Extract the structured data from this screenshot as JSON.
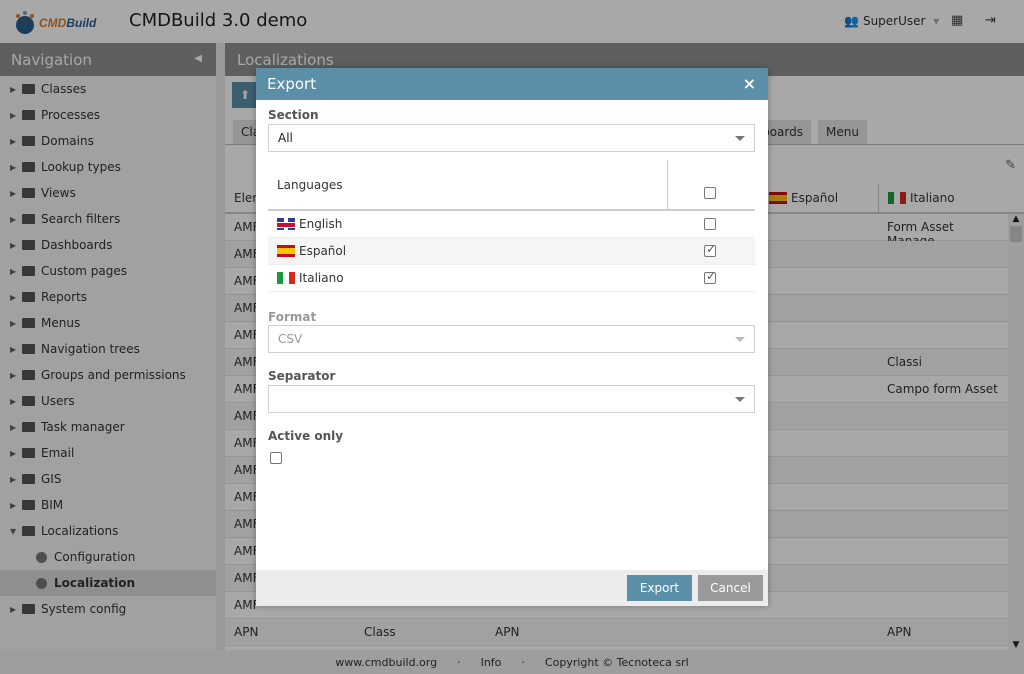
{
  "header": {
    "logo_text": "CMDBuild",
    "app_title": "CMDBuild 3.0 demo",
    "user": "SuperUser"
  },
  "nav": {
    "title": "Navigation",
    "items": [
      {
        "label": "Classes"
      },
      {
        "label": "Processes"
      },
      {
        "label": "Domains"
      },
      {
        "label": "Lookup types"
      },
      {
        "label": "Views"
      },
      {
        "label": "Search filters"
      },
      {
        "label": "Dashboards"
      },
      {
        "label": "Custom pages"
      },
      {
        "label": "Reports"
      },
      {
        "label": "Menus"
      },
      {
        "label": "Navigation trees"
      },
      {
        "label": "Groups and permissions"
      },
      {
        "label": "Users"
      },
      {
        "label": "Task manager"
      },
      {
        "label": "Email"
      },
      {
        "label": "GIS"
      },
      {
        "label": "BIM"
      },
      {
        "label": "Localizations"
      },
      {
        "label": "Configuration"
      },
      {
        "label": "Localization"
      },
      {
        "label": "System config"
      }
    ]
  },
  "main": {
    "title": "Localizations",
    "tabs": [
      "Cla",
      "boards",
      "Menu"
    ],
    "columns": [
      "Elem",
      "Español",
      "Italiano"
    ],
    "rows": [
      {
        "c1": "AMF",
        "c5": "Form Asset Manage..."
      },
      {
        "c1": "AMF"
      },
      {
        "c1": "AMF"
      },
      {
        "c1": "AMF"
      },
      {
        "c1": "AMF"
      },
      {
        "c1": "AMF",
        "c5": "Classi"
      },
      {
        "c1": "AMF",
        "c5": "Campo form Asset ..."
      },
      {
        "c1": "AMF"
      },
      {
        "c1": "AMF"
      },
      {
        "c1": "AMF"
      },
      {
        "c1": "AMF"
      },
      {
        "c1": "AMF"
      },
      {
        "c1": "AMF"
      },
      {
        "c1": "AMF"
      },
      {
        "c1": "AMF"
      },
      {
        "c1": "APN",
        "c2": "Class",
        "c3": "APN",
        "c5": "APN"
      }
    ]
  },
  "footer": {
    "site": "www.cmdbuild.org",
    "info": "Info",
    "copyright": "Copyright © Tecnoteca srl",
    "sep": "·"
  },
  "dialog": {
    "title": "Export",
    "close": "×",
    "section_label": "Section",
    "section_value": "All",
    "languages_header": "Languages",
    "select_all_checked": false,
    "languages": [
      {
        "name": "English",
        "flag": "en",
        "checked": false
      },
      {
        "name": "Español",
        "flag": "es",
        "checked": true
      },
      {
        "name": "Italiano",
        "flag": "it",
        "checked": true
      }
    ],
    "format_label": "Format",
    "format_value": "CSV",
    "separator_label": "Separator",
    "separator_value": "",
    "active_only_label": "Active only",
    "active_only_checked": false,
    "export_label": "Export",
    "cancel_label": "Cancel"
  },
  "colors": {
    "accent": "#5b8fa8",
    "panel_header": "#909090",
    "cancel": "#9a9a9a"
  }
}
